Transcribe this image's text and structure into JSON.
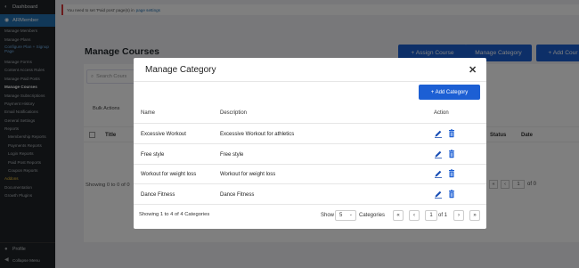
{
  "sidebar": {
    "dashboard": "Dashboard",
    "plugin": "ARMember",
    "items": [
      {
        "label": "Manage Members",
        "cls": ""
      },
      {
        "label": "Manage Plans",
        "cls": ""
      },
      {
        "label": "Configure Plan + Signup Page",
        "cls": "hl tall"
      },
      {
        "label": "Manage Forms",
        "cls": ""
      },
      {
        "label": "Content Access Rules",
        "cls": ""
      },
      {
        "label": "Manage Paid Posts",
        "cls": ""
      },
      {
        "label": "Manage Courses",
        "cls": "cur"
      },
      {
        "label": "Manage Subscriptions",
        "cls": ""
      },
      {
        "label": "Payment History",
        "cls": ""
      },
      {
        "label": "Email Notifications",
        "cls": ""
      },
      {
        "label": "General Settings",
        "cls": ""
      },
      {
        "label": "Reports",
        "cls": ""
      },
      {
        "label": "Membership Reports",
        "cls": "ind"
      },
      {
        "label": "Payments Reports",
        "cls": "ind"
      },
      {
        "label": "Login Reports",
        "cls": "ind"
      },
      {
        "label": "Paid Post Reports",
        "cls": "ind"
      },
      {
        "label": "Coupon Reports",
        "cls": "ind"
      },
      {
        "label": "Addons",
        "cls": "yellow"
      },
      {
        "label": "Documentation",
        "cls": ""
      },
      {
        "label": "Growth Plugins",
        "cls": ""
      }
    ],
    "profile": "Profile",
    "collapse": "Collapse Menu"
  },
  "notice": {
    "text": "You need to set 'Paid post' page(s) in",
    "link": "page settings"
  },
  "page": {
    "title": "Manage Courses",
    "assign_btn": "+ Assign Course",
    "manage_cat_btn": "Manage Category",
    "add_course_btn": "+ Add Cour",
    "search_placeholder": "Search Cours",
    "bulk_actions": "Bulk Actions",
    "col_title": "Title",
    "col_status": "Status",
    "col_date": "Date",
    "showing": "Showing 0 to 0 of 0",
    "pager_page": "1",
    "pager_of": "of 0"
  },
  "modal": {
    "title": "Manage Category",
    "close": "✕",
    "add_button": "+ Add Category",
    "headers": {
      "name": "Name",
      "description": "Description",
      "action": "Action"
    },
    "rows": [
      {
        "name": "Excessive Workout",
        "description": "Excessive Workout for athletics"
      },
      {
        "name": "Free style",
        "description": "Free style"
      },
      {
        "name": "Workout for weight loss",
        "description": "Workout for weight loss"
      },
      {
        "name": "Dance Fitness",
        "description": "Dance Fitness"
      }
    ],
    "footer_info": "Showing 1 to 4 of 4 Categories",
    "show_label": "Show",
    "per_page": "5",
    "categories_label": "Categories",
    "current_page": "1",
    "of_pages": "of 1"
  },
  "colors": {
    "accent": "#1c5fd4",
    "sidebar_bg": "#1e2327",
    "active": "#2271b1"
  }
}
